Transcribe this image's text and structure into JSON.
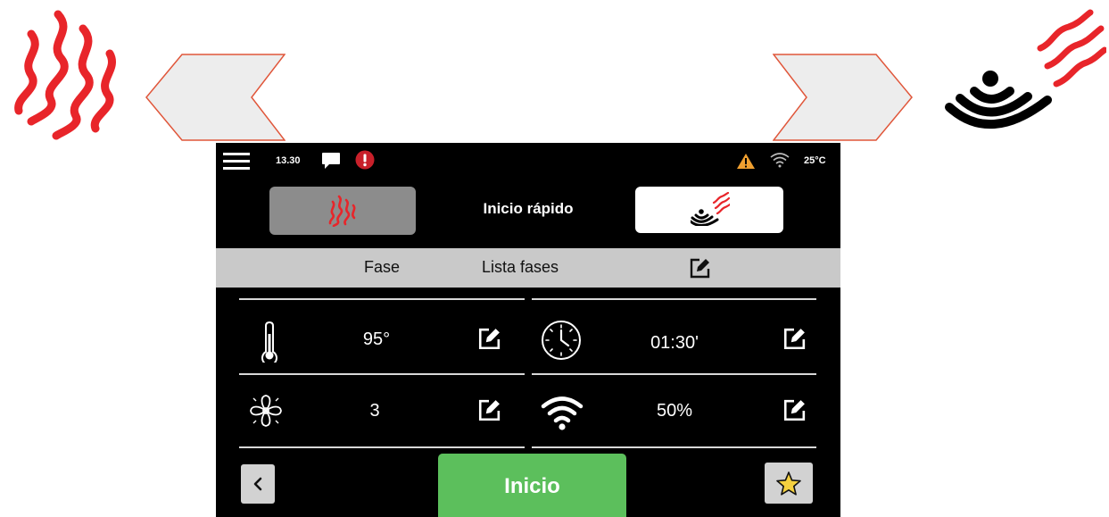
{
  "colors": {
    "heat_red": "#e8252a",
    "screen_bg": "#000000",
    "start_green": "#5cbf5c",
    "warning_orange": "#f0a030",
    "alert_red": "#c8202a",
    "arrow_outline": "#e0563a"
  },
  "status_bar": {
    "time": "13.30",
    "temperature": "25°C",
    "icons": [
      "menu-icon",
      "chat-icon",
      "alert-icon",
      "warning-icon",
      "wifi-icon"
    ]
  },
  "mode": {
    "title": "Inicio rápido",
    "left_icon": "heat-waves-icon",
    "right_icon": "steam-signal-icon"
  },
  "fase_bar": {
    "fase_label": "Fase",
    "list_label": "Lista fases",
    "edit_icon": "edit-icon"
  },
  "params": {
    "temperature": {
      "value": "95°",
      "icon": "thermometer-icon"
    },
    "time": {
      "value": "01:30'",
      "icon": "clock-icon"
    },
    "fan": {
      "value": "3",
      "icon": "fan-icon"
    },
    "humidity": {
      "value": "50%",
      "icon": "signal-icon"
    }
  },
  "bottom": {
    "start_label": "Inicio",
    "back_icon": "chevron-left-icon",
    "favorite_icon": "star-icon"
  },
  "annotations": {
    "left": "heat-waves-icon",
    "right": "steam-signal-icon"
  }
}
